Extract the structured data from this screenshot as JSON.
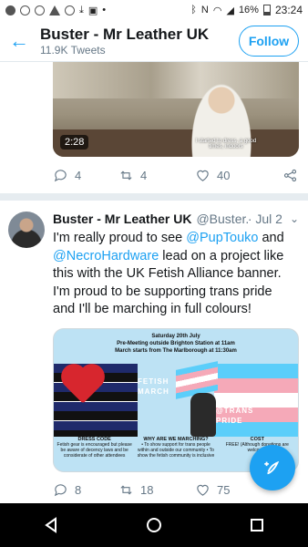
{
  "status_bar": {
    "battery": "16%",
    "time": "23:24"
  },
  "header": {
    "title": "Buster - Mr Leather UK",
    "subtitle": "11.9K Tweets",
    "follow_label": "Follow"
  },
  "tweet1": {
    "video_time": "2:28",
    "video_caption": "I started to dress, a good times, indoors",
    "replies": "4",
    "retweets": "4",
    "likes": "40"
  },
  "tweet2": {
    "name": "Buster - Mr Leather UK",
    "handle": "@Buster...",
    "time": "· Jul 2",
    "body_1": "I'm really proud to see ",
    "mention_1": "@PupTouko",
    "body_2": " and ",
    "mention_2": "@NecroHardware",
    "body_3": " lead on a project like this with the UK Fetish Alliance banner. I'm proud to be supporting trans pride and I'll be marching in full colours!",
    "banner": {
      "line1": "Saturday 20th July",
      "line2": "Pre-Meeting outside Brighton Station at 11am",
      "line3": "March starts from The Marlborough at 11:30am",
      "fetish_march": "FETISH MARCH",
      "trans_pride": "@TRANS PRIDE",
      "dress_code_head": "DRESS CODE",
      "dress_code_text": "Fetish gear is encouraged but please be aware of decency laws and be considerate of other attendees",
      "why_head": "WHY ARE WE MARCHING?",
      "why_text": "• To show support for trans people within and outside our community • To show the fetish community is inclusive",
      "cost_head": "COST",
      "cost_text": "FREE! (Although donations are welcome)"
    },
    "replies": "8",
    "retweets": "18",
    "likes": "75"
  },
  "colors": {
    "accent": "#1da1f2",
    "text": "#14171a",
    "muted": "#657786"
  }
}
